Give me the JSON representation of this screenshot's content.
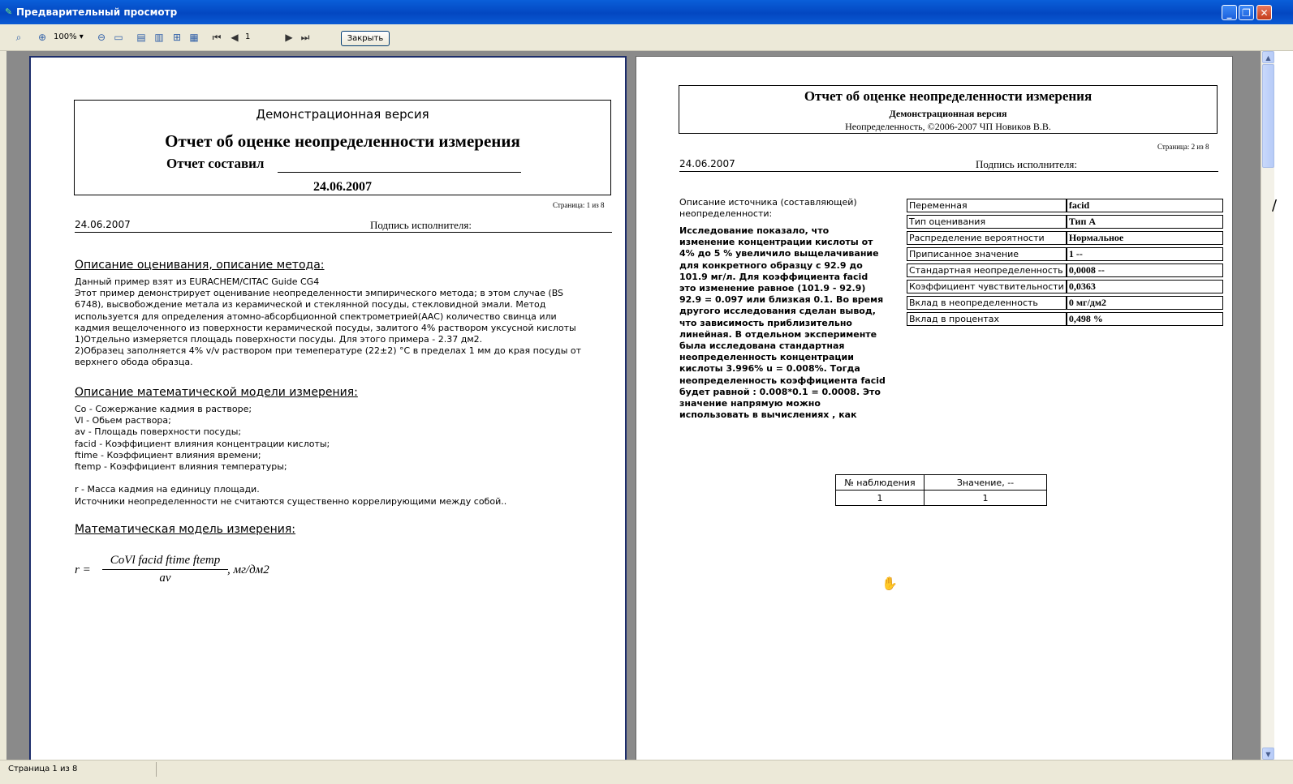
{
  "window": {
    "title": "Предварительный просмотр",
    "min_glyph": "_",
    "max_glyph": "❐",
    "close_glyph": "✕"
  },
  "toolbar": {
    "zoom_value": "100%",
    "page_value": "1",
    "close_label": "Закрыть",
    "icons": [
      "binoculars-icon",
      "zoom-in-icon",
      "zoom-out-icon",
      "fit-page-icon",
      "single-page-icon",
      "two-pages-icon",
      "book-icon",
      "settings-icon",
      "first-page-icon",
      "prev-page-icon",
      "next-page-icon",
      "last-page-icon"
    ]
  },
  "status": {
    "text": "Страница 1 из 8"
  },
  "page1": {
    "demo": "Демонстрационная версия",
    "title": "Отчет об оценке неопределенности измерения",
    "author_label": "Отчет составил",
    "date_big": "24.06.2007",
    "page_no": "Страница: 1 из 8",
    "date": "24.06.2007",
    "signature": "Подпись исполнителя:",
    "sec1_title": "Описание оценивания, описание метода:",
    "sec1_text": "Данный пример взят из EURACHEM/CITAC Guide CG4\nЭтот пример демонстрирует оценивание неопределенности эмпирического метода; в этом случае (BS 6748), высвобождение метала из керамической и стеклянной посуды, стекловидной эмали. Метод используется для определения атомно-абсорбционной спектрометрией(ААС) количество свинца или кадмия вещелоченного из поверхности керамической посуды, залитого 4% раствором уксусной кислоты\n1)Отдельно измеряется площадь поверхности посуды. Для этого примера - 2.37 дм2.\n2)Образец заполняется  4% v/v  раствором при темепературе (22±2) °C  в пределах 1 мм до края посуды от верхнего обода образца.",
    "sec2_title": "Описание математической модели измерения:",
    "sec2_text": "Co - Сожержание кадмия в растворе;\nVl - Обьем раствора;\nav - Площадь поверхности посуды;\nfacid - Коэффициент влияния концентрации кислоты;\nftime - Коэффициент влияния времени;\nftemp - Коэффициент влияния температуры;\n\nr - Масса кадмия на единицу площади.\nИсточники неопределенности не считаются существенно коррелирующими между собой..",
    "sec3_title": "Математическая модель измерения:",
    "formula_lhs": "r =",
    "formula_num": "CoVl facid ftime ftemp",
    "formula_den": "av",
    "formula_unit": ",  мг/дм2"
  },
  "page2": {
    "title": "Отчет об оценке неопределенности измерения",
    "demo": "Демонстрационная версия",
    "copyright": "Неопределенность, ©2006-2007 ЧП Новиков В.В.",
    "page_no": "Страница: 2 из 8",
    "date": "24.06.2007",
    "signature": "Подпись исполнителя:",
    "desc_label": "Описание источника (составляющей) неопределенности:",
    "desc_text": "Исследование показало, что изменение концентрации кислоты от 4% до 5 % увеличило выщелачивание для конкретного образцу с 92.9 до 101.9 мг/л.\nДля коэффициента facid это изменение равное (101.9 - 92.9) 92.9 = 0.097 или близкая 0.1.\nВо время другого исследования сделан вывод, что зависимость приблизительно линейная.\nВ отдельном эксперименте была исследована стандартная неопределенность концентрации кислоты 3.996% u = 0.008%. Тогда неопределенность коэффициента facid будет равной : 0.008*0.1 = 0.0008. Это значение напрямую можно использовать в вычислениях , как",
    "props": [
      {
        "key": "Переменная",
        "value": "facid"
      },
      {
        "key": "Тип оценивания",
        "value": "Тип А"
      },
      {
        "key": "Распределение вероятности",
        "value": "Нормальное"
      },
      {
        "key": "Приписанное значение",
        "value": "1  --"
      },
      {
        "key": "Стандартная неопределенность",
        "value": "0,0008  --"
      },
      {
        "key": "Коэффициент чувствительности",
        "value": "0,0363"
      },
      {
        "key": "Вклад в неопределенность",
        "value": "0   мг/дм2"
      },
      {
        "key": "Вклад в процентах",
        "value": "0,498  %"
      }
    ],
    "obs_header_n": "№ наблюдения",
    "obs_header_v": "Значение, --",
    "obs_n": "1",
    "obs_v": "1"
  },
  "edge_char": "/"
}
